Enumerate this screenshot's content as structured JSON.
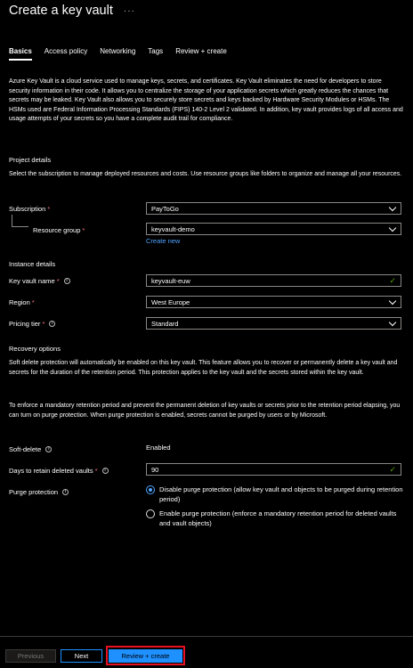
{
  "header": {
    "title": "Create a key vault",
    "more": "···"
  },
  "tabs": [
    "Basics",
    "Access policy",
    "Networking",
    "Tags",
    "Review + create"
  ],
  "intro": "Azure Key Vault is a cloud service used to manage keys, secrets, and certificates. Key Vault eliminates the need for developers to store security information in their code. It allows you to centralize the storage of your application secrets which greatly reduces the chances that secrets may be leaked. Key Vault also allows you to securely store secrets and keys backed by Hardware Security Modules or HSMs. The HSMs used are Federal Information Processing Standards (FIPS) 140-2 Level 2 validated. In addition, key vault provides logs of all access and usage attempts of your secrets so you have a complete audit trail for compliance.",
  "project": {
    "heading": "Project details",
    "desc": "Select the subscription to manage deployed resources and costs. Use resource groups like folders to organize and manage all your resources.",
    "subscription_label": "Subscription",
    "subscription_value": "PayToGo",
    "rg_label": "Resource group",
    "rg_value": "keyvault-demo",
    "create_new": "Create new"
  },
  "instance": {
    "heading": "Instance details",
    "name_label": "Key vault name",
    "name_value": "keyvault-euw",
    "region_label": "Region",
    "region_value": "West Europe",
    "tier_label": "Pricing tier",
    "tier_value": "Standard"
  },
  "recovery": {
    "heading": "Recovery options",
    "soft_desc": "Soft delete protection will automatically be enabled on this key vault. This feature allows you to recover or permanently delete a key vault and secrets for the duration of the retention period. This protection applies to the key vault and the secrets stored within the key vault.",
    "purge_desc": "To enforce a mandatory retention period and prevent the permanent deletion of key vaults or secrets prior to the retention period elapsing, you can turn on purge protection. When purge protection is enabled, secrets cannot be purged by users or by Microsoft.",
    "soft_label": "Soft-delete",
    "soft_value": "Enabled",
    "days_label": "Days to retain deleted vaults",
    "days_value": "90",
    "purge_label": "Purge protection",
    "option_disable": "Disable purge protection (allow key vault and objects to be purged during retention period)",
    "option_enable": "Enable purge protection (enforce a mandatory retention period for deleted vaults and vault objects)"
  },
  "footer": {
    "previous": "Previous",
    "next": "Next",
    "review": "Review + create"
  }
}
